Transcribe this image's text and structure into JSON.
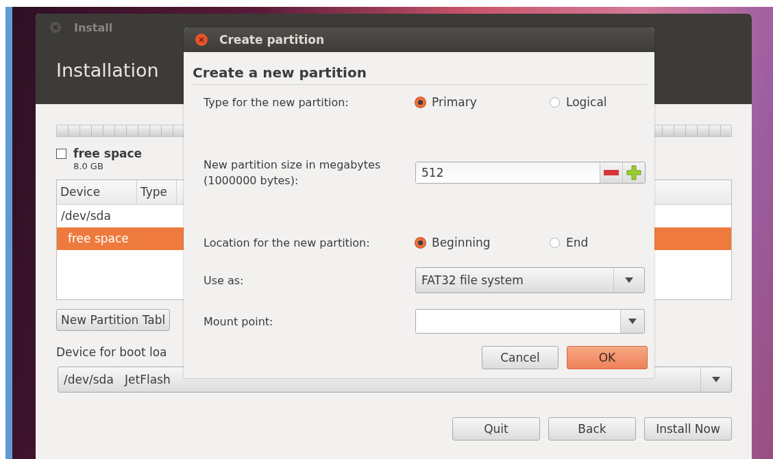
{
  "install_window": {
    "title": "Install",
    "heading": "Installation",
    "legend": {
      "label": "free space",
      "size": "8.0 GB",
      "checked": false
    },
    "table": {
      "columns": [
        "Device",
        "Type"
      ],
      "rows": [
        {
          "device": "/dev/sda",
          "selected": false,
          "children": [
            {
              "device": "free space",
              "selected": true
            }
          ]
        }
      ]
    },
    "new_partition_table_button": "New Partition Tabl",
    "boot_loader": {
      "label": "Device for boot loa",
      "value": "/dev/sda   JetFlash"
    },
    "buttons": [
      "Quit",
      "Back",
      "Install Now"
    ]
  },
  "dialog": {
    "title": "Create partition",
    "heading": "Create a new partition",
    "type": {
      "label": "Type for the new partition:",
      "options": [
        {
          "label": "Primary",
          "selected": true
        },
        {
          "label": "Logical",
          "selected": false
        }
      ]
    },
    "size": {
      "label": "New partition size in megabytes (1000000 bytes):",
      "value": "512"
    },
    "location": {
      "label": "Location for the new partition:",
      "options": [
        {
          "label": "Beginning",
          "selected": true
        },
        {
          "label": "End",
          "selected": false
        }
      ]
    },
    "use_as": {
      "label": "Use as:",
      "value": "FAT32 file system"
    },
    "mount_point": {
      "label": "Mount point:"
    },
    "buttons": [
      {
        "label": "Cancel",
        "kind": "normal"
      },
      {
        "label": "OK",
        "kind": "default"
      }
    ]
  }
}
